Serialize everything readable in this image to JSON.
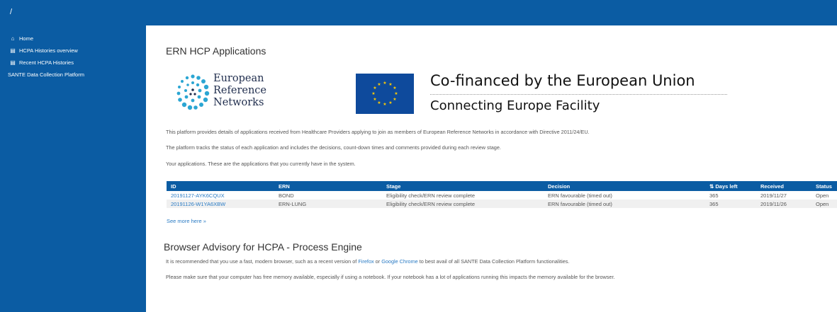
{
  "topbar": {
    "breadcrumb": "/"
  },
  "sidebar": {
    "items": [
      {
        "icon": "home-icon",
        "glyph": "⌂",
        "label": "Home"
      },
      {
        "icon": "histories-icon",
        "glyph": "▤",
        "label": "HCPA Histories overview"
      },
      {
        "icon": "histories-icon",
        "glyph": "▤",
        "label": "Recent HCPA Histories"
      },
      {
        "icon": "",
        "glyph": "",
        "label": "SANTE Data Collection Platform"
      }
    ]
  },
  "main": {
    "title": "ERN HCP Applications",
    "ern_logo": {
      "line1": "European",
      "line2": "Reference",
      "line3": "Networks"
    },
    "cofinanced": {
      "title": "Co-financed by the European Union",
      "subtitle": "Connecting Europe Facility"
    },
    "paragraphs": [
      "This platform provides details of applications received from Healthcare Providers applying to join as members of European Reference Networks in accordance with Directive 2011/24/EU.",
      "The platform tracks the status of each application and includes the decisions, count-down times and comments provided during each review stage.",
      "Your applications. These are the applications that you currently have in the system."
    ],
    "table": {
      "columns": [
        "ID",
        "ERN",
        "Stage",
        "Decision",
        "Days left",
        "Received",
        "Status"
      ],
      "rows": [
        {
          "id": "20191127-AYK6CQUX",
          "ern": "BOND",
          "stage": "Eligibility check/ERN review complete",
          "decision": "ERN favourable (timed out)",
          "days_left": "365",
          "received": "2019/11/27",
          "status": "Open"
        },
        {
          "id": "20191126-W1YA6XBW",
          "ern": "ERN-LUNG",
          "stage": "Eligibility check/ERN review complete",
          "decision": "ERN favourable (timed out)",
          "days_left": "365",
          "received": "2019/11/26",
          "status": "Open"
        }
      ]
    },
    "see_more": "See more here »",
    "advisory": {
      "title": "Browser Advisory for HCPA - Process Engine",
      "line1_pre": "It is recommended that you use a fast, modern browser, such as a recent version of ",
      "firefox": "Firefox",
      "or": " or ",
      "chrome": "Google Chrome",
      "line1_post": " to best avail of all SANTE Data Collection Platform functionalities.",
      "line2": "Please make sure that your computer has free memory available, especially if using a notebook. If your notebook has a lot of applications running this impacts the memory available for the browser."
    }
  },
  "colors": {
    "brand": "#0b5ca3",
    "link": "#2a7bc4",
    "eu_blue": "#0e4a9c",
    "eu_star": "#ffcc00"
  }
}
